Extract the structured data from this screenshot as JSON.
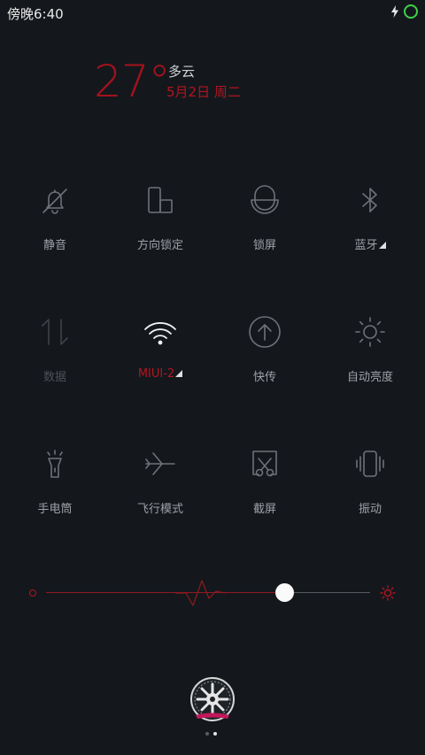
{
  "status_bar": {
    "time": "傍晚6:40",
    "icons": [
      "charging-bolt-icon",
      "battery-ring-icon"
    ],
    "battery_color": "#3fd24a"
  },
  "weather": {
    "temperature": "27°",
    "condition": "多云",
    "date": "5月2日 周二",
    "accent_color": "#b3141f"
  },
  "toggles": [
    {
      "label": "静音",
      "icon": "bell-off-icon",
      "state": "off"
    },
    {
      "label": "方向锁定",
      "icon": "rotation-lock-icon",
      "state": "off"
    },
    {
      "label": "锁屏",
      "icon": "lock-icon",
      "state": "off"
    },
    {
      "label": "蓝牙",
      "icon": "bluetooth-icon",
      "state": "off",
      "has_more": true
    },
    {
      "label": "数据",
      "icon": "mobile-data-icon",
      "state": "disabled"
    },
    {
      "label": "MIUI-2",
      "icon": "wifi-icon",
      "state": "on",
      "has_more": true
    },
    {
      "label": "快传",
      "icon": "quick-transfer-icon",
      "state": "off"
    },
    {
      "label": "自动亮度",
      "icon": "auto-brightness-icon",
      "state": "off"
    },
    {
      "label": "手电筒",
      "icon": "flashlight-icon",
      "state": "off"
    },
    {
      "label": "飞行模式",
      "icon": "airplane-icon",
      "state": "off"
    },
    {
      "label": "截屏",
      "icon": "screenshot-icon",
      "state": "off"
    },
    {
      "label": "振动",
      "icon": "vibrate-icon",
      "state": "off"
    }
  ],
  "brightness": {
    "level_fraction": 0.73,
    "min_icon": "brightness-low-icon",
    "max_icon": "brightness-high-icon"
  },
  "pager": {
    "pages": 2,
    "active": 1
  }
}
